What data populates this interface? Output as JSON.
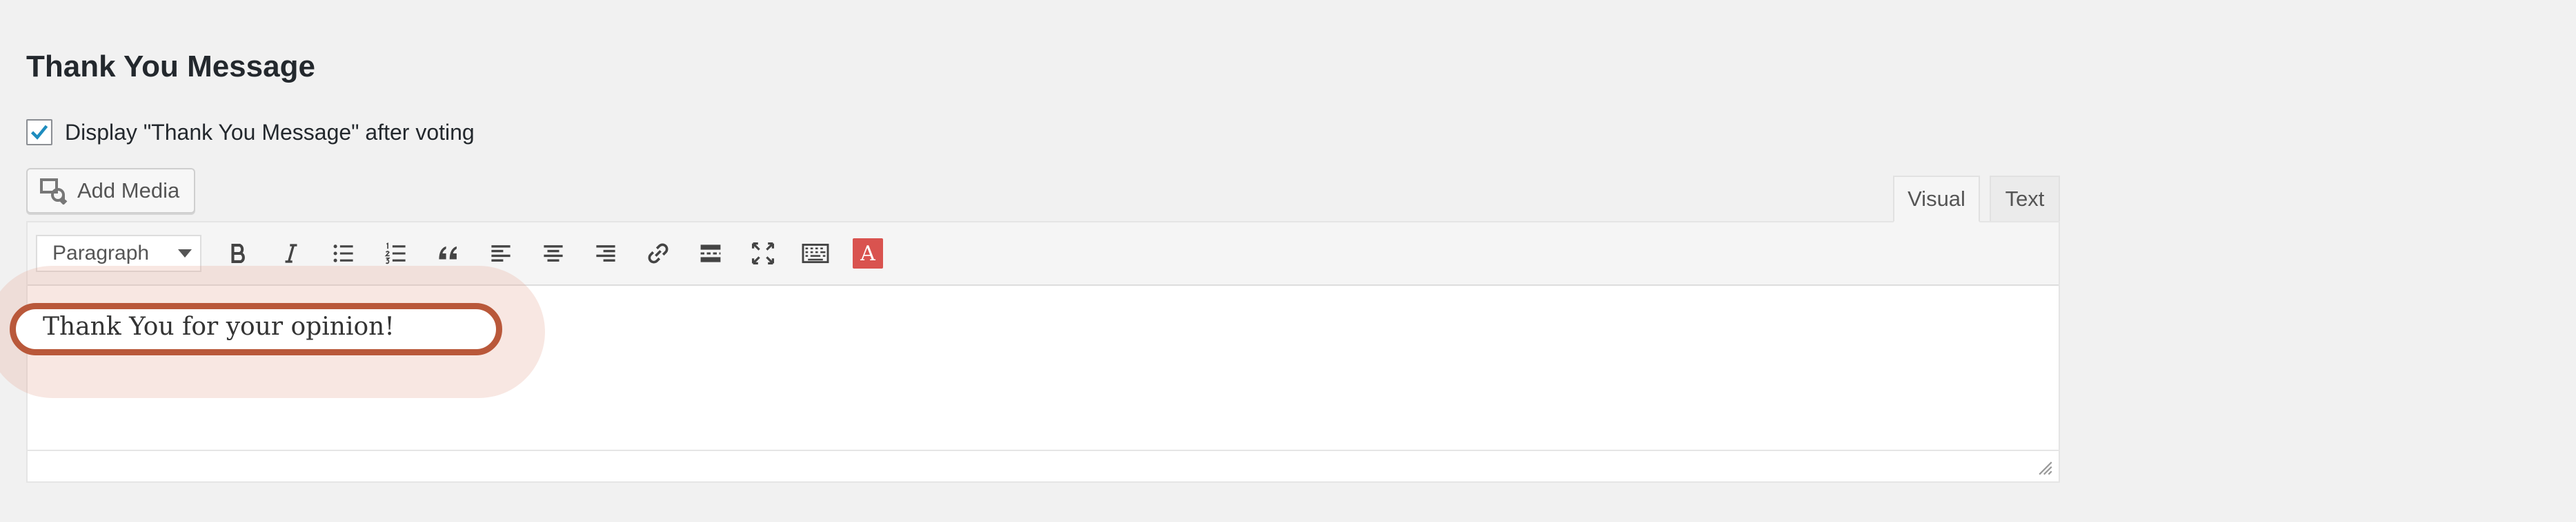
{
  "section": {
    "title": "Thank You Message",
    "display_checkbox": {
      "label": "Display \"Thank You Message\" after voting",
      "checked": true
    }
  },
  "editor": {
    "add_media_label": "Add Media",
    "tabs": [
      {
        "label": "Visual",
        "active": true
      },
      {
        "label": "Text",
        "active": false
      }
    ],
    "format_select": {
      "value": "Paragraph"
    },
    "toolbar_icons": [
      "bold-icon",
      "italic-icon",
      "bullet-list-icon",
      "numbered-list-icon",
      "blockquote-icon",
      "align-left-icon",
      "align-center-icon",
      "align-right-icon",
      "link-icon",
      "read-more-icon",
      "fullscreen-icon",
      "toolbar-toggle-icon",
      "text-color-icon"
    ],
    "text_color_glyph": "A",
    "content": "Thank You for your opinion!"
  },
  "colors": {
    "highlight_ring": "#b9583a",
    "checkbox_check": "#1e8cbe",
    "text_color_button": "#d9534f"
  }
}
